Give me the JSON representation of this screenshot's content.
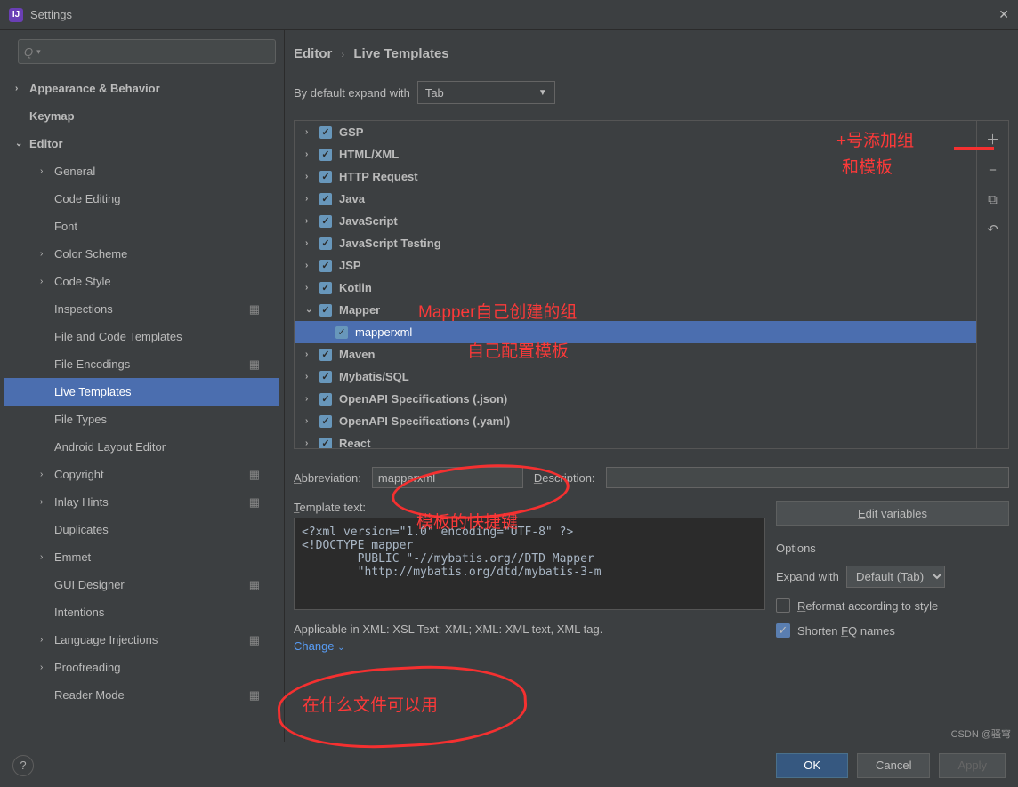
{
  "window": {
    "title": "Settings"
  },
  "search": {
    "placeholder": "Q"
  },
  "sidebarTree": [
    {
      "label": "Appearance & Behavior",
      "arrow": "›",
      "l": 0,
      "bold": true
    },
    {
      "label": "Keymap",
      "arrow": "",
      "l": 0,
      "bold": true
    },
    {
      "label": "Editor",
      "arrow": "⌄",
      "l": 0,
      "bold": true
    },
    {
      "label": "General",
      "arrow": "›",
      "l": 1
    },
    {
      "label": "Code Editing",
      "arrow": "",
      "l": 1
    },
    {
      "label": "Font",
      "arrow": "",
      "l": 1
    },
    {
      "label": "Color Scheme",
      "arrow": "›",
      "l": 1
    },
    {
      "label": "Code Style",
      "arrow": "›",
      "l": 1
    },
    {
      "label": "Inspections",
      "arrow": "",
      "l": 1,
      "gear": true
    },
    {
      "label": "File and Code Templates",
      "arrow": "",
      "l": 1
    },
    {
      "label": "File Encodings",
      "arrow": "",
      "l": 1,
      "gear": true
    },
    {
      "label": "Live Templates",
      "arrow": "",
      "l": 1,
      "selected": true
    },
    {
      "label": "File Types",
      "arrow": "",
      "l": 1
    },
    {
      "label": "Android Layout Editor",
      "arrow": "",
      "l": 1
    },
    {
      "label": "Copyright",
      "arrow": "›",
      "l": 1,
      "gear": true
    },
    {
      "label": "Inlay Hints",
      "arrow": "›",
      "l": 1,
      "gear": true
    },
    {
      "label": "Duplicates",
      "arrow": "",
      "l": 1
    },
    {
      "label": "Emmet",
      "arrow": "›",
      "l": 1
    },
    {
      "label": "GUI Designer",
      "arrow": "",
      "l": 1,
      "gear": true
    },
    {
      "label": "Intentions",
      "arrow": "",
      "l": 1
    },
    {
      "label": "Language Injections",
      "arrow": "›",
      "l": 1,
      "gear": true
    },
    {
      "label": "Proofreading",
      "arrow": "›",
      "l": 1
    },
    {
      "label": "Reader Mode",
      "arrow": "",
      "l": 1,
      "gear": true
    }
  ],
  "breadcrumb": {
    "a": "Editor",
    "b": "Live Templates"
  },
  "expand": {
    "label": "By default expand with",
    "value": "Tab"
  },
  "templates": [
    {
      "label": "GSP",
      "arrow": "›",
      "bold": true
    },
    {
      "label": "HTML/XML",
      "arrow": "›",
      "bold": true
    },
    {
      "label": "HTTP Request",
      "arrow": "›",
      "bold": true
    },
    {
      "label": "Java",
      "arrow": "›",
      "bold": true
    },
    {
      "label": "JavaScript",
      "arrow": "›",
      "bold": true
    },
    {
      "label": "JavaScript Testing",
      "arrow": "›",
      "bold": true
    },
    {
      "label": "JSP",
      "arrow": "›",
      "bold": true
    },
    {
      "label": "Kotlin",
      "arrow": "›",
      "bold": true
    },
    {
      "label": "Mapper",
      "arrow": "⌄",
      "bold": true
    },
    {
      "label": "mapperxml",
      "arrow": "",
      "child": true,
      "selected": true
    },
    {
      "label": "Maven",
      "arrow": "›",
      "bold": true
    },
    {
      "label": "Mybatis/SQL",
      "arrow": "›",
      "bold": true
    },
    {
      "label": "OpenAPI Specifications (.json)",
      "arrow": "›",
      "bold": true
    },
    {
      "label": "OpenAPI Specifications (.yaml)",
      "arrow": "›",
      "bold": true
    },
    {
      "label": "React",
      "arrow": "›",
      "bold": true
    }
  ],
  "detail": {
    "abbrLabel": "Abbreviation:",
    "abbr": "mapperxml",
    "descLabel": "Description:",
    "desc": "",
    "textLabel": "Template text:",
    "code": "<?xml version=\"1.0\" encoding=\"UTF-8\" ?>\n<!DOCTYPE mapper\n        PUBLIC \"-//mybatis.org//DTD Mapper\n        \"http://mybatis.org/dtd/mybatis-3-m",
    "editVars": "Edit variables",
    "optionsTitle": "Options",
    "expandWith": "Expand with",
    "expandVal": "Default (Tab)",
    "reformat": "Reformat according to style",
    "shorten": "Shorten FQ names",
    "applicable": "Applicable in XML: XSL Text; XML; XML: XML text, XML tag.",
    "change": "Change"
  },
  "footer": {
    "ok": "OK",
    "cancel": "Cancel",
    "apply": "Apply"
  },
  "annot": {
    "addGroup1": "+号添加组",
    "addGroup2": "和模板",
    "mapperGroup": "Mapper自己创建的组",
    "selfTemplate": "自己配置模板",
    "shortcut": "模板的快捷键",
    "usable": "在什么文件可以用"
  },
  "watermark": "CSDN @骚穹"
}
